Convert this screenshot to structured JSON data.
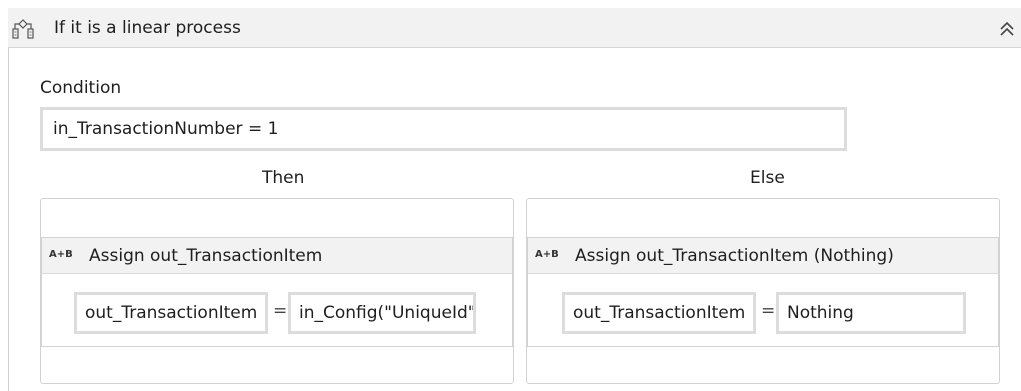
{
  "activity": {
    "title": "If it is a linear process",
    "icon": "if-branch-icon",
    "collapse_icon": "double-chevron-up-icon"
  },
  "condition": {
    "label": "Condition",
    "value": "in_TransactionNumber = 1"
  },
  "then_branch": {
    "label": "Then",
    "assign": {
      "icon_text": "A+B",
      "title": "Assign out_TransactionItem",
      "to_value": "out_TransactionItem",
      "operator": "=",
      "value": "in_Config(\"UniqueId\")"
    }
  },
  "else_branch": {
    "label": "Else",
    "assign": {
      "icon_text": "A+B",
      "title": "Assign out_TransactionItem (Nothing)",
      "to_value": "out_TransactionItem",
      "operator": "=",
      "value": "Nothing"
    }
  },
  "colors": {
    "header_bg": "#f2f2f2",
    "border": "#d2d2d2",
    "field_border": "#dcdcdc"
  }
}
